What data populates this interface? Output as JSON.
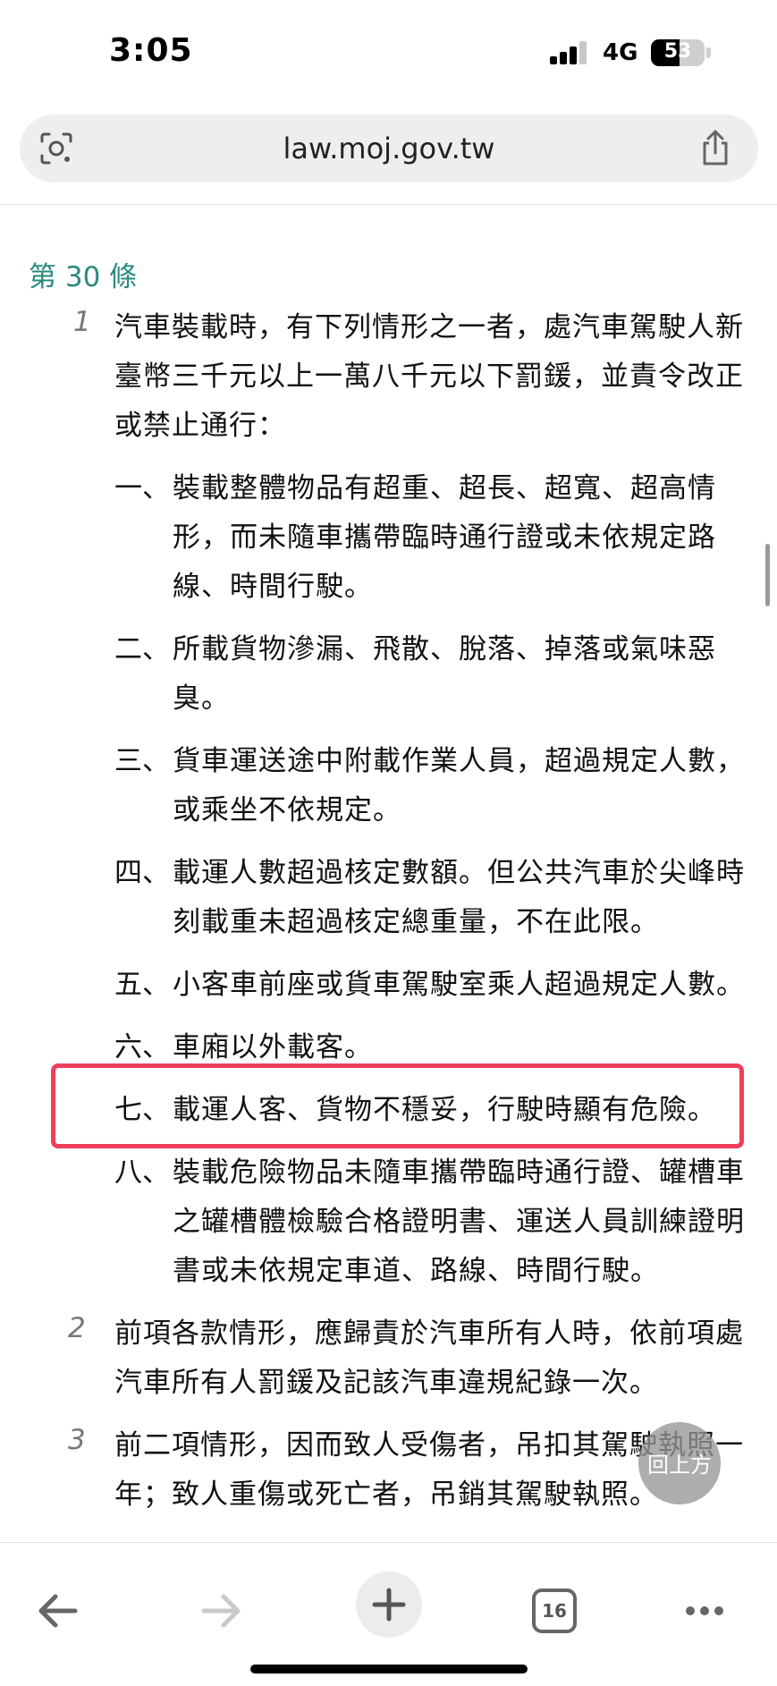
{
  "status_bar": {
    "time": "3:05",
    "network": "4G",
    "battery": "53",
    "battery_level": 0.53
  },
  "browser": {
    "url": "law.moj.gov.tw",
    "tab_count": "16"
  },
  "article": {
    "heading": "第 30 條",
    "paragraphs": [
      {
        "num": "1",
        "lines": [
          "汽車裝載時，有下列情形之一者，處汽車駕駛人新",
          "臺幣三千元以上一萬八千元以下罰鍰，並責令改正",
          "或禁止通行："
        ]
      },
      {
        "num": "2",
        "lines": [
          "前項各款情形，應歸責於汽車所有人時，依前項處",
          "汽車所有人罰鍰及記該汽車違規紀錄一次。"
        ]
      },
      {
        "num": "3",
        "lines": [
          "前二項情形，因而致人受傷者，吊扣其駕駛執照一",
          "年；致人重傷或死亡者，吊銷其駕駛執照。"
        ]
      }
    ],
    "items": [
      {
        "num": "一、",
        "lines": [
          "裝載整體物品有超重、超長、超寬、超高情",
          "形，而未隨車攜帶臨時通行證或未依規定路",
          "線、時間行駛。"
        ]
      },
      {
        "num": "二、",
        "lines": [
          "所載貨物滲漏、飛散、脫落、掉落或氣味惡",
          "臭。"
        ]
      },
      {
        "num": "三、",
        "lines": [
          "貨車運送途中附載作業人員，超過規定人數，",
          "或乘坐不依規定。"
        ]
      },
      {
        "num": "四、",
        "lines": [
          "載運人數超過核定數額。但公共汽車於尖峰時",
          "刻載重未超過核定總重量，不在此限。"
        ]
      },
      {
        "num": "五、",
        "lines": [
          "小客車前座或貨車駕駛室乘人超過規定人數。"
        ]
      },
      {
        "num": "六、",
        "lines": [
          "車廂以外載客。"
        ]
      },
      {
        "num": "七、",
        "lines": [
          "載運人客、貨物不穩妥，行駛時顯有危險。"
        ]
      },
      {
        "num": "八、",
        "lines": [
          "裝載危險物品未隨車攜帶臨時通行證、罐槽車",
          "之罐槽體檢驗合格證明書、運送人員訓練證明",
          "書或未依規定車道、路線、時間行駛。"
        ]
      }
    ]
  },
  "back_to_top_label": "回上方",
  "colors": {
    "heading": "#2a8a7e",
    "highlight": "#ef3f5c"
  },
  "icons": [
    "lens-icon",
    "share-icon",
    "back-arrow-icon",
    "forward-arrow-icon",
    "plus-icon",
    "tabs-icon",
    "more-icon"
  ]
}
